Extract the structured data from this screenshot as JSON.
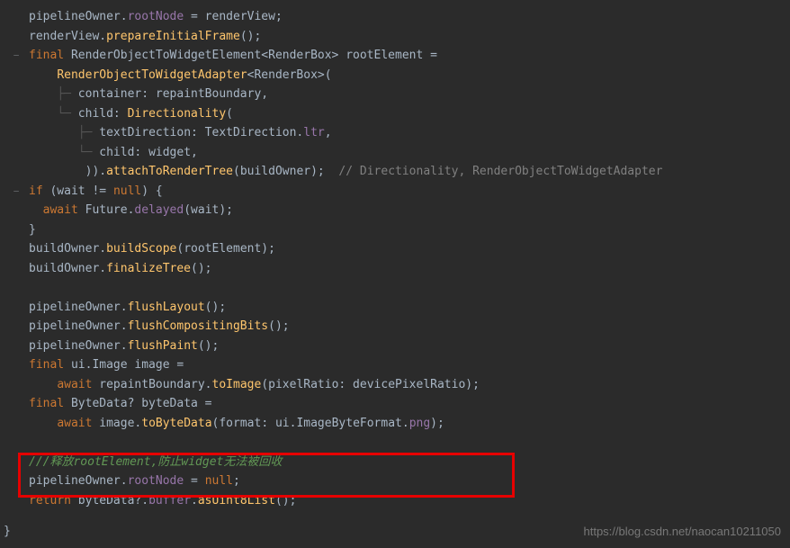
{
  "code": {
    "l1a": "pipelineOwner.",
    "l1b": "rootNode",
    "l1c": " = renderView;",
    "l2a": "renderView.",
    "l2b": "prepareInitialFrame",
    "l2c": "();",
    "l3a": "final",
    "l3b": " RenderObjectToWidgetElement<RenderBox> rootElement =",
    "l4a": "RenderObjectToWidgetAdapter",
    "l4b": "<RenderBox>(",
    "l5a": "container: repaintBoundary,",
    "l6a": "child: ",
    "l6b": "Directionality",
    "l6c": "(",
    "l7a": "textDirection: TextDirection.",
    "l7b": "ltr",
    "l7c": ",",
    "l8a": "child: widget,",
    "l9a": ")).",
    "l9b": "attachToRenderTree",
    "l9c": "(buildOwner);",
    "l9comment": "  // Directionality, RenderObjectToWidgetAdapter",
    "l10a": "if",
    "l10b": " (wait != ",
    "l10c": "null",
    "l10d": ") {",
    "l11a": "await",
    "l11b": " Future.",
    "l11c": "delayed",
    "l11d": "(wait);",
    "l12a": "}",
    "l13a": "buildOwner.",
    "l13b": "buildScope",
    "l13c": "(rootElement);",
    "l14a": "buildOwner.",
    "l14b": "finalizeTree",
    "l14c": "();",
    "l16a": "pipelineOwner.",
    "l16b": "flushLayout",
    "l16c": "();",
    "l17a": "pipelineOwner.",
    "l17b": "flushCompositingBits",
    "l17c": "();",
    "l18a": "pipelineOwner.",
    "l18b": "flushPaint",
    "l18c": "();",
    "l19a": "final",
    "l19b": " ui.Image image =",
    "l20a": "await",
    "l20b": " repaintBoundary.",
    "l20c": "toImage",
    "l20d": "(pixelRatio: devicePixelRatio);",
    "l21a": "final",
    "l21b": " ByteData? byteData =",
    "l22a": "await",
    "l22b": " image.",
    "l22c": "toByteData",
    "l22d": "(format: ui.ImageByteFormat.",
    "l22e": "png",
    "l22f": ");",
    "l24comment": "///释放rootElement,防止widget无法被回收",
    "l25a": "pipelineOwner.",
    "l25b": "rootNode",
    "l25c": " = ",
    "l25d": "null",
    "l25e": ";",
    "l26a": "return",
    "l26b": " byteData?.",
    "l26c": "buffer",
    "l26d": ".",
    "l26e": "asUint8List",
    "l26f": "();"
  },
  "closing_brace": "}",
  "watermark": "https://blog.csdn.net/naocan10211050",
  "fold_minus": "−",
  "guide_v": "│",
  "guide_t": "├─",
  "guide_l": "└─"
}
